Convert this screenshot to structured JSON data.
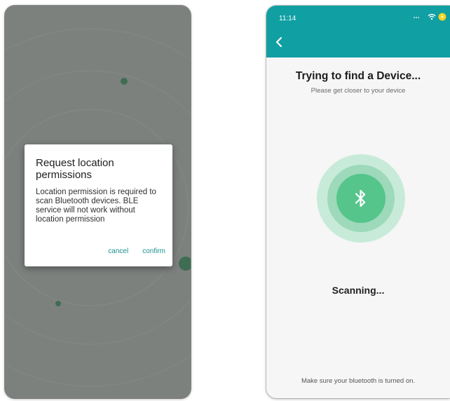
{
  "left_screen": {
    "dialog": {
      "title": "Request location permissions",
      "message": "Location permission is required to scan Bluetooth devices. BLE service will not work without location permission",
      "cancel_label": "cancel",
      "confirm_label": "confirm"
    }
  },
  "right_screen": {
    "status_bar": {
      "time": "11:14"
    },
    "header": {
      "back_icon": "chevron-left-icon"
    },
    "title": "Trying to find a Device...",
    "subtitle": "Please get closer to your device",
    "center_icon": "bluetooth-icon",
    "status_text": "Scanning...",
    "footer_note": "Make sure your bluetooth is turned on."
  },
  "colors": {
    "header_teal": "#109fa3",
    "accent_green": "#55c58b",
    "dialog_button": "#1d8e8e",
    "overlay_gray": "#7d817e"
  }
}
